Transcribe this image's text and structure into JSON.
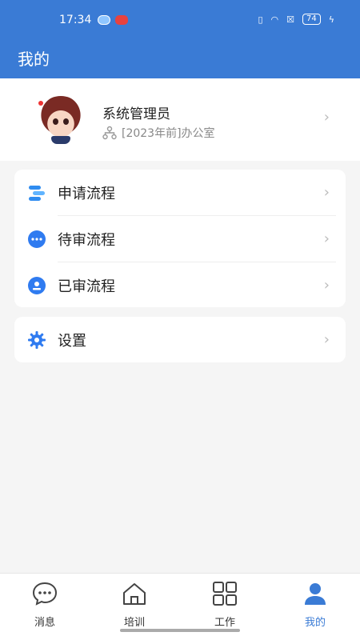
{
  "status_bar": {
    "time": "17:34",
    "battery": "74"
  },
  "header": {
    "title": "我的"
  },
  "profile": {
    "name": "系统管理员",
    "org": "[2023年前]办公室"
  },
  "menu": {
    "items": [
      {
        "label": "申请流程",
        "icon": "apply-process-icon"
      },
      {
        "label": "待审流程",
        "icon": "pending-process-icon"
      },
      {
        "label": "已审流程",
        "icon": "reviewed-process-icon"
      }
    ],
    "settings": {
      "label": "设置",
      "icon": "settings-gear-icon"
    }
  },
  "tabbar": {
    "tabs": [
      {
        "label": "消息",
        "icon": "message-icon"
      },
      {
        "label": "培训",
        "icon": "training-home-icon"
      },
      {
        "label": "工作",
        "icon": "work-grid-icon"
      },
      {
        "label": "我的",
        "icon": "profile-person-icon",
        "active": true
      }
    ]
  },
  "colors": {
    "primary": "#3a7bd5",
    "active_tab": "#3a7bd5",
    "background": "#f5f5f5"
  }
}
